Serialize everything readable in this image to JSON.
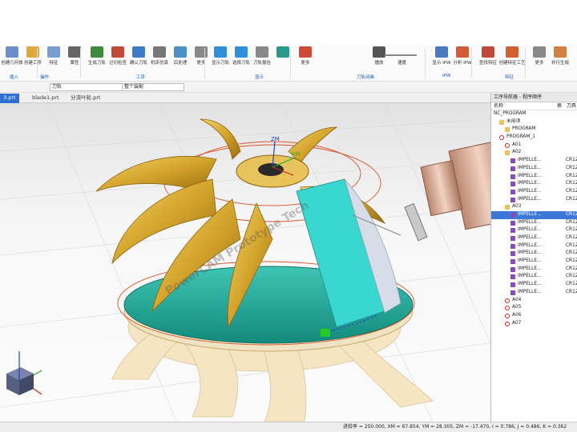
{
  "ribbon": {
    "buttons": [
      {
        "label": "创建几何体",
        "color": "#6b8fc7"
      },
      {
        "label": "创建工序",
        "color": "#e0a83a"
      },
      {
        "label": "特征",
        "color": "#7a9ed0"
      },
      {
        "label": "属性",
        "color": "#666"
      },
      {
        "label": "生成刀轨",
        "color": "#3d8b3d"
      },
      {
        "label": "过切检查",
        "color": "#c04a3a"
      },
      {
        "label": "确认刀轨",
        "color": "#3d7bc7"
      },
      {
        "label": "机床仿真",
        "color": "#777"
      },
      {
        "label": "后处理",
        "color": "#4a90c0"
      },
      {
        "label": "更多",
        "color": "#888"
      },
      {
        "label": "显示刀轨",
        "color": "#2f8fd8"
      },
      {
        "label": "选择刀轨",
        "color": "#2f8fd8"
      },
      {
        "label": "刀轨报告",
        "color": "#888"
      },
      {
        "label": "",
        "color": "#2a9a8a"
      },
      {
        "label": "更多",
        "color": "#d04a3a"
      },
      {
        "label": "播放",
        "color": "#555"
      },
      {
        "label": "显示 IPW",
        "color": "#4a7bc0"
      },
      {
        "label": "分析 IPW",
        "color": "#d05a3a"
      },
      {
        "label": "查找特征",
        "color": "#c04a3a"
      },
      {
        "label": "创建特征工艺",
        "color": "#d06030"
      },
      {
        "label": "更多",
        "color": "#888"
      },
      {
        "label": "并行生成",
        "color": "#d08040"
      }
    ],
    "groups": [
      "插入",
      "操作",
      "工序",
      "显示",
      "刀轨动画",
      "IPW",
      "特征"
    ],
    "speed_label": "速度"
  },
  "toolbar2": {
    "filter": "刀轨",
    "scope": "整个装配"
  },
  "tabs": [
    {
      "label": "3.prt",
      "active": true
    },
    {
      "label": "blade1.prt",
      "active": false
    },
    {
      "label": "分流叶轮.prt",
      "active": false
    }
  ],
  "viewport": {
    "watermark": "PowerCAM Prototype Tech",
    "axis_zm": "ZM",
    "axis_ym": "YM"
  },
  "navigator": {
    "title": "工序导航器 - 程序顺序",
    "col_name": "名称",
    "col_change": "换",
    "col_tool": "刀具",
    "rows": [
      {
        "name": "NC_PROGRAM",
        "indent": 0,
        "tool": "",
        "icon": "none",
        "selected": false
      },
      {
        "name": "未用项",
        "indent": 1,
        "tool": "",
        "icon": "folder",
        "selected": false
      },
      {
        "name": "PROGRAM",
        "indent": 2,
        "tool": "",
        "icon": "folder",
        "selected": false
      },
      {
        "name": "PROGRAM_1",
        "indent": 1,
        "tool": "",
        "icon": "nofolder",
        "selected": false
      },
      {
        "name": "A01",
        "indent": 2,
        "tool": "",
        "icon": "nofolder",
        "selected": false
      },
      {
        "name": "A02",
        "indent": 2,
        "tool": "",
        "icon": "folder",
        "selected": false
      },
      {
        "name": "IMPELLE...",
        "indent": 3,
        "tool": "CR12",
        "icon": "op",
        "selected": false
      },
      {
        "name": "IMPELLE...",
        "indent": 3,
        "tool": "CR12",
        "icon": "op",
        "selected": false
      },
      {
        "name": "IMPELLE...",
        "indent": 3,
        "tool": "CR12",
        "icon": "op",
        "selected": false
      },
      {
        "name": "IMPELLE...",
        "indent": 3,
        "tool": "CR12",
        "icon": "op",
        "selected": false
      },
      {
        "name": "IMPELLE...",
        "indent": 3,
        "tool": "CR12",
        "icon": "op",
        "selected": false
      },
      {
        "name": "IMPELLE...",
        "indent": 3,
        "tool": "CR12",
        "icon": "op",
        "selected": false
      },
      {
        "name": "A03",
        "indent": 2,
        "tool": "",
        "icon": "folder",
        "selected": false
      },
      {
        "name": "IMPELLE...",
        "indent": 3,
        "tool": "CR12",
        "icon": "op",
        "selected": true
      },
      {
        "name": "IMPELLE...",
        "indent": 3,
        "tool": "CR12",
        "icon": "op",
        "selected": false
      },
      {
        "name": "IMPELLE...",
        "indent": 3,
        "tool": "CR12",
        "icon": "op",
        "selected": false
      },
      {
        "name": "IMPELLE...",
        "indent": 3,
        "tool": "CR12",
        "icon": "op",
        "selected": false
      },
      {
        "name": "IMPELLE...",
        "indent": 3,
        "tool": "CR12",
        "icon": "op",
        "selected": false
      },
      {
        "name": "IMPELLE...",
        "indent": 3,
        "tool": "CR12",
        "icon": "op",
        "selected": false
      },
      {
        "name": "IMPELLE...",
        "indent": 3,
        "tool": "CR12",
        "icon": "op",
        "selected": false
      },
      {
        "name": "IMPELLE...",
        "indent": 3,
        "tool": "CR12",
        "icon": "op",
        "selected": false
      },
      {
        "name": "IMPELLE...",
        "indent": 3,
        "tool": "CR12",
        "icon": "op",
        "selected": false
      },
      {
        "name": "IMPELLE...",
        "indent": 3,
        "tool": "CR12",
        "icon": "op",
        "selected": false
      },
      {
        "name": "IMPELLE...",
        "indent": 3,
        "tool": "CR12",
        "icon": "op",
        "selected": false
      },
      {
        "name": "A04",
        "indent": 2,
        "tool": "",
        "icon": "nofolder",
        "selected": false
      },
      {
        "name": "A05",
        "indent": 2,
        "tool": "",
        "icon": "nofolder",
        "selected": false
      },
      {
        "name": "A06",
        "indent": 2,
        "tool": "",
        "icon": "nofolder",
        "selected": false
      },
      {
        "name": "A07",
        "indent": 2,
        "tool": "",
        "icon": "nofolder",
        "selected": false
      }
    ]
  },
  "status": "进给率 = 250.000, XM = 67.854, YM = 28.305, ZM = -17.470, I = 0.786, J = 0.486, K = 0.362",
  "colors": {
    "accent": "#2f6fd0",
    "blade": "#d9b13a",
    "hub": "#1fa89a",
    "selection": "#3b78d8"
  }
}
